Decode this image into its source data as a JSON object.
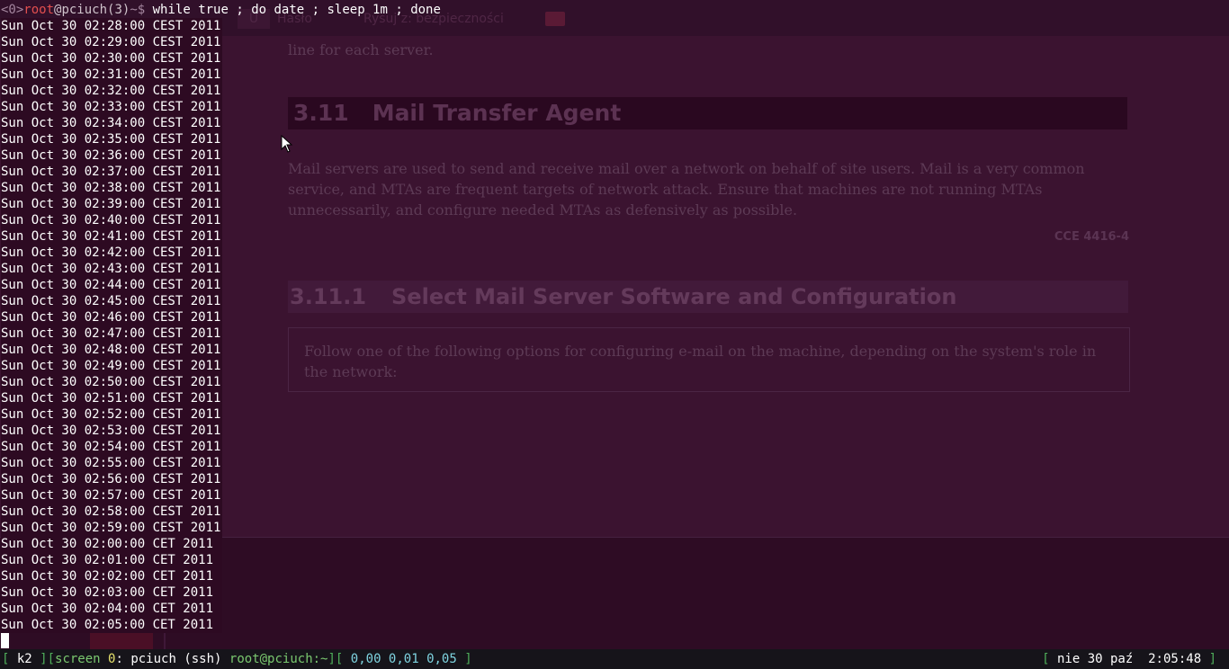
{
  "background_document": {
    "tabs": [
      "U",
      "Hasło",
      "Rysuj z: bezpieczności"
    ],
    "intro_line": "line for each server.",
    "section": {
      "number": "3.11",
      "title": "Mail Transfer Agent"
    },
    "paragraph": "Mail servers are used to send and receive mail over a network on behalf of site users. Mail is a very common service, and MTAs are frequent targets of network attack. Ensure that machines are not running MTAs unnecessarily, and configure needed MTAs as defensively as possible.",
    "cce": "CCE 4416-4",
    "subsection": {
      "number": "3.11.1",
      "title": "Select Mail Server Software and Configuration"
    },
    "box_text": "Follow one of the following options for configuring e-mail on the machine, depending on the system's role in the network:"
  },
  "terminal": {
    "prompt": {
      "badge": "<0>",
      "user": "root",
      "at_host": "@pciuch",
      "window_num": "(3)",
      "path": "~$",
      "command": " while true ; do date ; sleep 1m ; done"
    },
    "output_lines": [
      "Sun Oct 30 02:28:00 CEST 2011",
      "Sun Oct 30 02:29:00 CEST 2011",
      "Sun Oct 30 02:30:00 CEST 2011",
      "Sun Oct 30 02:31:00 CEST 2011",
      "Sun Oct 30 02:32:00 CEST 2011",
      "Sun Oct 30 02:33:00 CEST 2011",
      "Sun Oct 30 02:34:00 CEST 2011",
      "Sun Oct 30 02:35:00 CEST 2011",
      "Sun Oct 30 02:36:00 CEST 2011",
      "Sun Oct 30 02:37:00 CEST 2011",
      "Sun Oct 30 02:38:00 CEST 2011",
      "Sun Oct 30 02:39:00 CEST 2011",
      "Sun Oct 30 02:40:00 CEST 2011",
      "Sun Oct 30 02:41:00 CEST 2011",
      "Sun Oct 30 02:42:00 CEST 2011",
      "Sun Oct 30 02:43:00 CEST 2011",
      "Sun Oct 30 02:44:00 CEST 2011",
      "Sun Oct 30 02:45:00 CEST 2011",
      "Sun Oct 30 02:46:00 CEST 2011",
      "Sun Oct 30 02:47:00 CEST 2011",
      "Sun Oct 30 02:48:00 CEST 2011",
      "Sun Oct 30 02:49:00 CEST 2011",
      "Sun Oct 30 02:50:00 CEST 2011",
      "Sun Oct 30 02:51:00 CEST 2011",
      "Sun Oct 30 02:52:00 CEST 2011",
      "Sun Oct 30 02:53:00 CEST 2011",
      "Sun Oct 30 02:54:00 CEST 2011",
      "Sun Oct 30 02:55:00 CEST 2011",
      "Sun Oct 30 02:56:00 CEST 2011",
      "Sun Oct 30 02:57:00 CEST 2011",
      "Sun Oct 30 02:58:00 CEST 2011",
      "Sun Oct 30 02:59:00 CEST 2011",
      "Sun Oct 30 02:00:00 CET 2011",
      "Sun Oct 30 02:01:00 CET 2011",
      "Sun Oct 30 02:02:00 CET 2011",
      "Sun Oct 30 02:03:00 CET 2011",
      "Sun Oct 30 02:04:00 CET 2011",
      "Sun Oct 30 02:05:00 CET 2011"
    ]
  },
  "status_bar": {
    "open_bracket": "[",
    "host_short": " k2 ",
    "mid_bracket": "][",
    "screen_label": "screen ",
    "screen_num": "0",
    "screen_name": ": pciuch (ssh)",
    "user_path": " root@pciuch:~",
    "load_open": "][",
    "load": " 0,00 0,01 0,05 ",
    "load_close": "]",
    "date_open": "[",
    "date": " nie 30 paź  2:05:48 ",
    "date_close": "]"
  },
  "colors": {
    "terminal_bg": "#2c0a20",
    "prompt_user": "#e24f4f",
    "status_bracket": "#4fae5a",
    "status_screen_num": "#e6e26c"
  }
}
